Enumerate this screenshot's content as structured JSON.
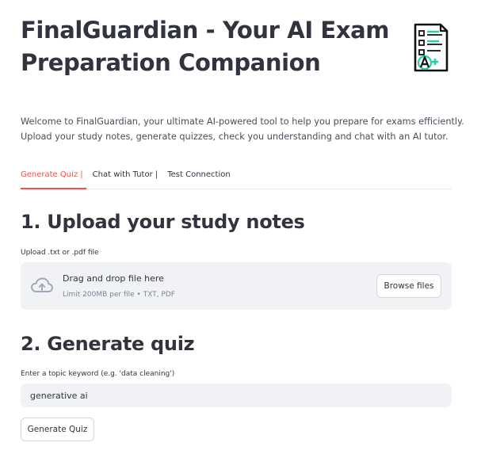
{
  "header": {
    "title": "FinalGuardian - Your AI Exam Preparation Companion",
    "logo_icon": "exam-grade-a-plus-icon"
  },
  "intro": {
    "text": "Welcome to FinalGuardian, your ultimate AI-powered tool to help you prepare for exams efficiently. Upload your study notes, generate quizzes, check you understanding and chat with an AI tutor."
  },
  "tabs": [
    {
      "label": "Generate Quiz |",
      "active": true
    },
    {
      "label": "Chat with Tutor |",
      "active": false
    },
    {
      "label": "Test Connection",
      "active": false
    }
  ],
  "upload_section": {
    "heading": "1. Upload your study notes",
    "field_label": "Upload .txt or .pdf file",
    "dropzone_text": "Drag and drop file here",
    "dropzone_hint": "Limit 200MB per file • TXT, PDF",
    "browse_label": "Browse files",
    "icon": "cloud-upload-icon"
  },
  "quiz_section": {
    "heading": "2. Generate quiz",
    "field_label": "Enter a topic keyword (e.g. 'data cleaning')",
    "input_value": "generative ai",
    "button_label": "Generate Quiz"
  },
  "colors": {
    "accent": "#ff4b4b",
    "text": "#31333f",
    "input_bg": "#f0f2f6",
    "logo_teal": "#25d0a6"
  }
}
